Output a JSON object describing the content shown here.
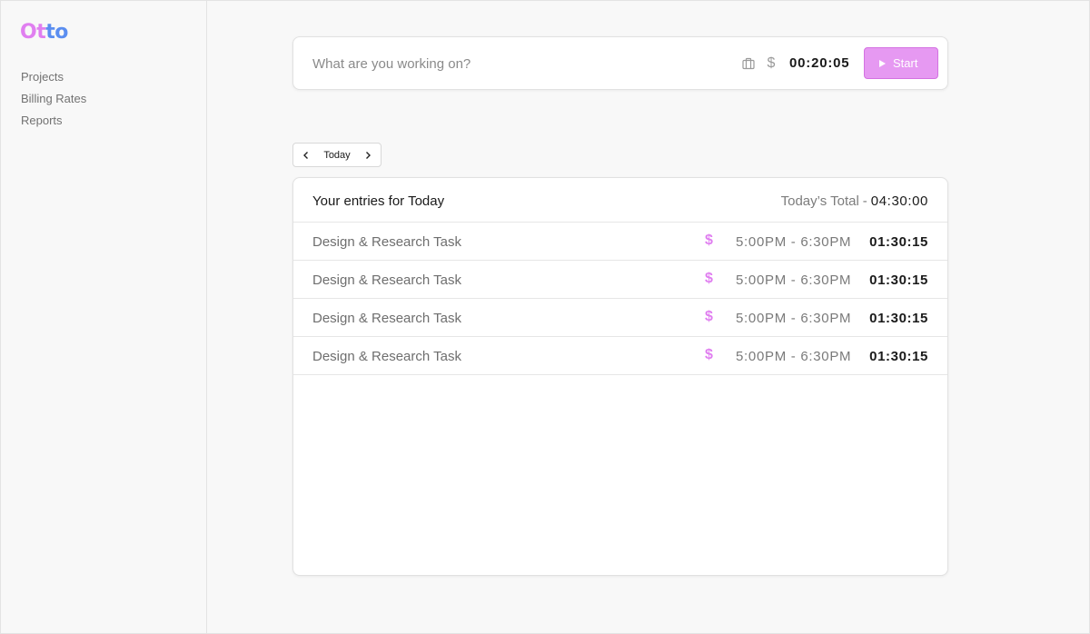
{
  "app": {
    "logo_letters": [
      "O",
      "t",
      "t",
      "o"
    ],
    "logo_colors": [
      "#e07ff0",
      "#e07ff0",
      "#5b8ef0",
      "#5b8ef0"
    ]
  },
  "sidebar": {
    "items": [
      {
        "label": "Projects"
      },
      {
        "label": "Billing Rates"
      },
      {
        "label": "Reports"
      }
    ]
  },
  "timer": {
    "placeholder": "What are you working on?",
    "project_icon": "briefcase-icon",
    "billable_icon": "dollar-icon",
    "billable_symbol": "$",
    "elapsed": "00:20:05",
    "start_label": "Start",
    "start_color": "#e699f2"
  },
  "date_nav": {
    "label": "Today"
  },
  "entries": {
    "title": "Your entries for Today",
    "total_label": "Today’s Total",
    "total_separator": "-",
    "total_value": "04:30:00",
    "billable_color": "#e07ff0",
    "rows": [
      {
        "description": "Design & Research Task",
        "billable": "$",
        "range": "5:00PM - 6:30PM",
        "duration": "01:30:15"
      },
      {
        "description": "Design & Research Task",
        "billable": "$",
        "range": "5:00PM - 6:30PM",
        "duration": "01:30:15"
      },
      {
        "description": "Design & Research Task",
        "billable": "$",
        "range": "5:00PM - 6:30PM",
        "duration": "01:30:15"
      },
      {
        "description": "Design & Research Task",
        "billable": "$",
        "range": "5:00PM - 6:30PM",
        "duration": "01:30:15"
      }
    ]
  }
}
